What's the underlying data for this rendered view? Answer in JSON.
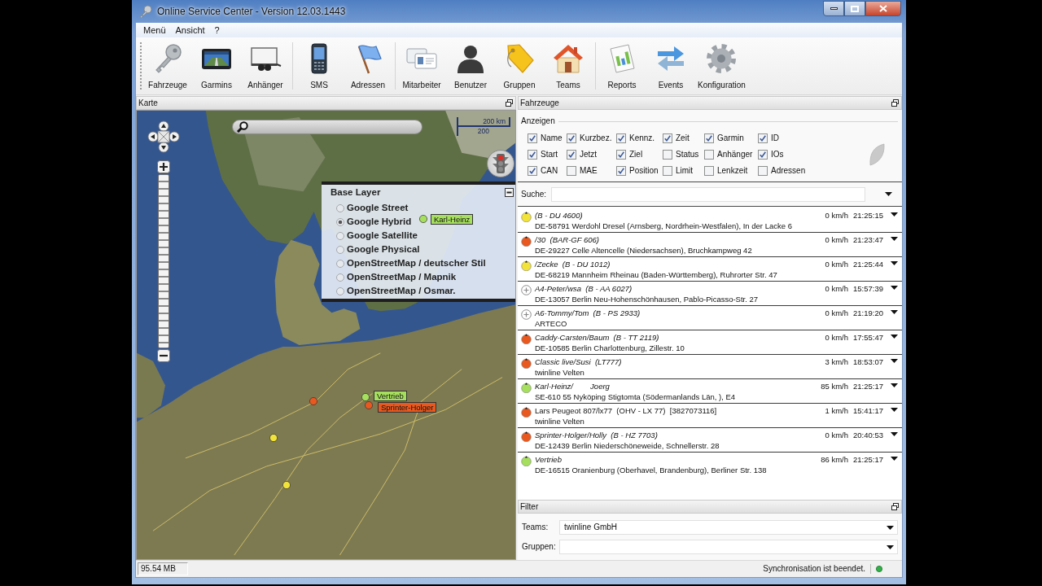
{
  "window": {
    "title": "Online Service Center - Version 12.03.1443"
  },
  "menu": [
    "Menü",
    "Ansicht",
    "?"
  ],
  "toolbar": [
    [
      "Fahrzeuge",
      "Garmins",
      "Anhänger"
    ],
    [
      "SMS",
      "Adressen"
    ],
    [
      "Mitarbeiter",
      "Benutzer",
      "Gruppen",
      "Teams"
    ],
    [
      "Reports",
      "Events",
      "Konfiguration"
    ]
  ],
  "map_panel": {
    "title": "Karte",
    "scale": [
      "200 km",
      "200"
    ],
    "base_layer": {
      "title": "Base Layer",
      "options": [
        {
          "label": "Google Street",
          "selected": false
        },
        {
          "label": "Google Hybrid",
          "selected": true
        },
        {
          "label": "Google Satellite",
          "selected": false
        },
        {
          "label": "Google Physical",
          "selected": false
        },
        {
          "label": "OpenStreetMap / deutscher Stil",
          "selected": false
        },
        {
          "label": "OpenStreetMap / Mapnik",
          "selected": false
        },
        {
          "label": "OpenStreetMap / Osmar.",
          "selected": false
        }
      ]
    },
    "markers": [
      {
        "label": "Karl-Heinz",
        "color": "#a6df5e"
      },
      {
        "label": "Vertrieb",
        "color": "#a6df5e"
      },
      {
        "label": "Sprinter-Holger",
        "color": "#e8581f"
      },
      {
        "color": "#e8581f"
      },
      {
        "color": "#f2e33a"
      },
      {
        "color": "#f2e33a"
      }
    ]
  },
  "vehicles_panel": {
    "title": "Fahrzeuge",
    "display": {
      "title": "Anzeigen",
      "options": [
        {
          "label": "Name",
          "checked": true
        },
        {
          "label": "Kurzbez.",
          "checked": true
        },
        {
          "label": "Kennz.",
          "checked": true
        },
        {
          "label": "Zeit",
          "checked": true
        },
        {
          "label": "Garmin",
          "checked": true
        },
        {
          "label": "ID",
          "checked": true
        },
        {
          "label": "Start",
          "checked": true
        },
        {
          "label": "Jetzt",
          "checked": true
        },
        {
          "label": "Ziel",
          "checked": true
        },
        {
          "label": "Status",
          "checked": false
        },
        {
          "label": "Anhänger",
          "checked": false
        },
        {
          "label": "IOs",
          "checked": true
        },
        {
          "label": "CAN",
          "checked": true
        },
        {
          "label": "MAE",
          "checked": false
        },
        {
          "label": "Position",
          "checked": true
        },
        {
          "label": "Limit",
          "checked": false
        },
        {
          "label": "Lenkzeit",
          "checked": false
        },
        {
          "label": "Adressen",
          "checked": false
        }
      ]
    },
    "search": {
      "label": "Suche:"
    },
    "vehicles": [
      {
        "kind": "dot",
        "color": "#f2e33a",
        "title": "(B - DU 4600)",
        "italic": true,
        "address": "DE-58791 Werdohl Dresel (Arnsberg, Nordrhein-Westfalen), In der Lacke 6",
        "speed": "0 km/h",
        "time": "21:25:15"
      },
      {
        "kind": "dot",
        "color": "#e8581f",
        "title": "/30  (BAR-GF 606)",
        "italic": true,
        "address": "DE-29227 Celle Altencelle (Niedersachsen), Bruchkampweg 42",
        "speed": "0 km/h",
        "time": "21:23:47"
      },
      {
        "kind": "dot",
        "color": "#f2e33a",
        "title": "/Zecke  (B - DU 1012)",
        "italic": true,
        "address": "DE-68219 Mannheim Rheinau (Baden-Württemberg), Ruhrorter Str. 47",
        "speed": "0 km/h",
        "time": "21:25:44"
      },
      {
        "kind": "idle",
        "title": "A4-Peter/wsa  (B - AA 6027)",
        "italic": true,
        "address": "DE-13057 Berlin Neu-Hohenschönhausen, Pablo-Picasso-Str. 27",
        "speed": "0 km/h",
        "time": "15:57:39"
      },
      {
        "kind": "idle",
        "title": "A6-Tommy/Tom  (B - PS 2933)",
        "italic": true,
        "address": "ARTECO",
        "speed": "0 km/h",
        "time": "21:19:20"
      },
      {
        "kind": "dot",
        "color": "#e8581f",
        "title": "Caddy-Carsten/Baum  (B - TT 2119)",
        "italic": true,
        "address": "DE-10585 Berlin Charlottenburg, Zillestr. 10",
        "speed": "0 km/h",
        "time": "17:55:47"
      },
      {
        "kind": "dot",
        "color": "#e8581f",
        "title": "Classic live/Susi  (LT777)",
        "italic": true,
        "address": "twinline Velten",
        "speed": "3 km/h",
        "time": "18:53:07"
      },
      {
        "kind": "dot",
        "color": "#a6df5e",
        "title": "Karl-Heinz/        Joerg",
        "italic": true,
        "address": "SE-610 55 Nyköping Stigtomta (Södermanlands Län, ), E4",
        "speed": "85 km/h",
        "time": "21:25:17"
      },
      {
        "kind": "dot",
        "color": "#e8581f",
        "title": "Lars Peugeot 807/lx77  (OHV - LX 77)  [3827073116]",
        "italic": false,
        "address": "twinline Velten",
        "speed": "1 km/h",
        "time": "15:41:17"
      },
      {
        "kind": "dot",
        "color": "#e8581f",
        "title": "Sprinter-Holger/Holly  (B - HZ 7703)",
        "italic": true,
        "address": "DE-12439 Berlin Niederschöneweide, Schnellerstr. 28",
        "speed": "0 km/h",
        "time": "20:40:53"
      },
      {
        "kind": "dot",
        "color": "#a6df5e",
        "title": "Vertrieb",
        "italic": true,
        "address": "DE-16515 Oranienburg (Oberhavel, Brandenburg), Berliner Str. 138",
        "speed": "86 km/h",
        "time": "21:25:17"
      }
    ]
  },
  "filter_panel": {
    "title": "Filter",
    "fields": [
      {
        "label": "Teams:",
        "value": "twinline GmbH"
      },
      {
        "label": "Gruppen:"
      }
    ]
  },
  "status_bar": {
    "memory": "95.54 MB",
    "message": "Synchronisation ist beendet."
  }
}
